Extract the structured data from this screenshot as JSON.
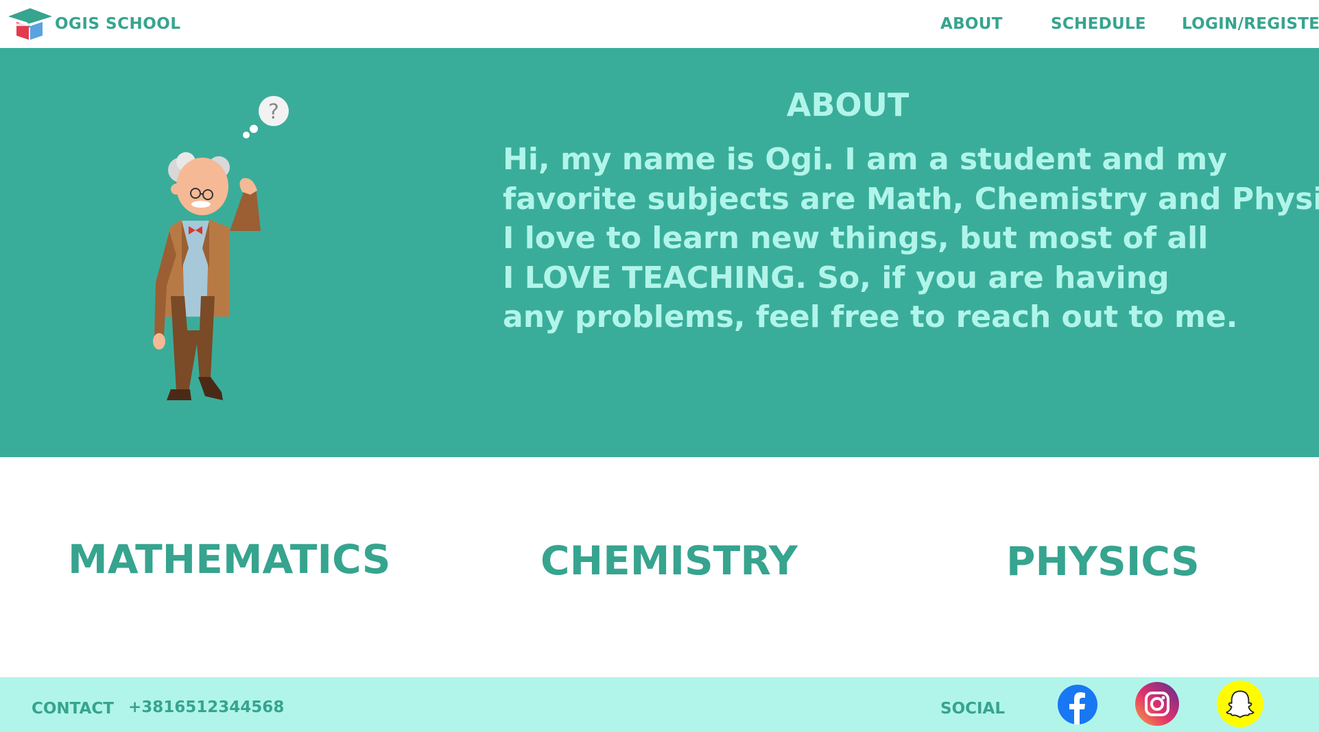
{
  "header": {
    "brand": "OGIS SCHOOL",
    "nav": {
      "about": "ABOUT",
      "schedule": "SCHEDULE",
      "login": "LOGIN/REGISTER"
    }
  },
  "hero": {
    "title": "ABOUT",
    "lines": [
      "Hi, my name is Ogi. I am a student and my",
      "favorite subjects are Math, Chemistry and Physics.",
      "I love to learn new things, but most of all",
      "I LOVE TEACHING. So, if you are having",
      "any problems, feel free to reach out to me."
    ],
    "thought_mark": "?"
  },
  "subjects": [
    "MATHEMATICS",
    "CHEMISTRY",
    "PHYSICS"
  ],
  "footer": {
    "contact_label": "CONTACT",
    "phone": "+3816512344568",
    "social_label": "SOCIAL",
    "icons": [
      "facebook-icon",
      "instagram-icon",
      "snapchat-icon"
    ]
  },
  "colors": {
    "brand_teal": "#36a48f",
    "hero_bg": "#3aad9a",
    "hero_text": "#b1f5ea",
    "footer_bg": "#b1f5ea",
    "facebook": "#1877f2",
    "snapchat": "#fffc00"
  }
}
